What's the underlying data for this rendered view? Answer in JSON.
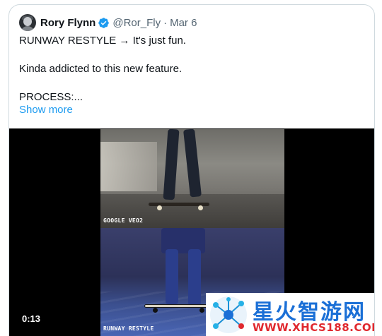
{
  "tweet": {
    "author": {
      "display_name": "Rory Flynn",
      "handle": "@Ror_Fly",
      "separator": "·",
      "date": "Mar 6",
      "verified_icon": "verified-badge-icon",
      "verified_color": "#1d9bf0"
    },
    "text_lines": [
      "RUNWAY RESTYLE → It's just fun.",
      "Kinda addicted to this new feature.",
      "PROCESS:..."
    ],
    "show_more_label": "Show more",
    "link_color": "#1d9bf0"
  },
  "media": {
    "top_frame_label": "GOOGLE VEO2",
    "bottom_frame_label": "RUNWAY RESTYLE",
    "elapsed_time": "0:13"
  },
  "watermark": {
    "title": "星火智游网",
    "url": "WWW.XHCS188.COM",
    "title_color": "#1a6fd6",
    "url_color": "#e0282e"
  }
}
